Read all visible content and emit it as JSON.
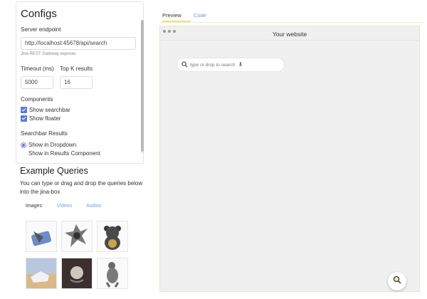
{
  "configs": {
    "title": "Configs",
    "server_endpoint_label": "Server endpoint",
    "server_endpoint_value": "http://localhost:45678/api/search",
    "server_hint": "Jina REST Gateway exposes",
    "timeout_label": "Timeout (ms)",
    "timeout_value": "5000",
    "topk_label": "Top K results",
    "topk_value": "16",
    "components_label": "Components",
    "show_searchbar": "Show searchbar",
    "show_floater": "Show floater",
    "results_label": "Searchbar Results",
    "show_dropdown": "Show in Dropdown",
    "show_results_component": "Show in Results Component"
  },
  "examples": {
    "title": "Example Queries",
    "description": "You can type or drag and drop the queries below into the jina-box",
    "tabs": [
      "Images",
      "Videos",
      "Audios"
    ]
  },
  "preview": {
    "tabs": [
      "Preview",
      "Code"
    ],
    "website_title": "Your website",
    "search_placeholder": "type or drop to search"
  },
  "colors": {
    "accent": "#5a7bd6",
    "tab_underline": "#e7e77a",
    "link": "#6f95d9"
  },
  "icons": [
    "search-icon",
    "microphone-icon",
    "checkbox-icon",
    "radio-icon",
    "window-dot-icon"
  ]
}
